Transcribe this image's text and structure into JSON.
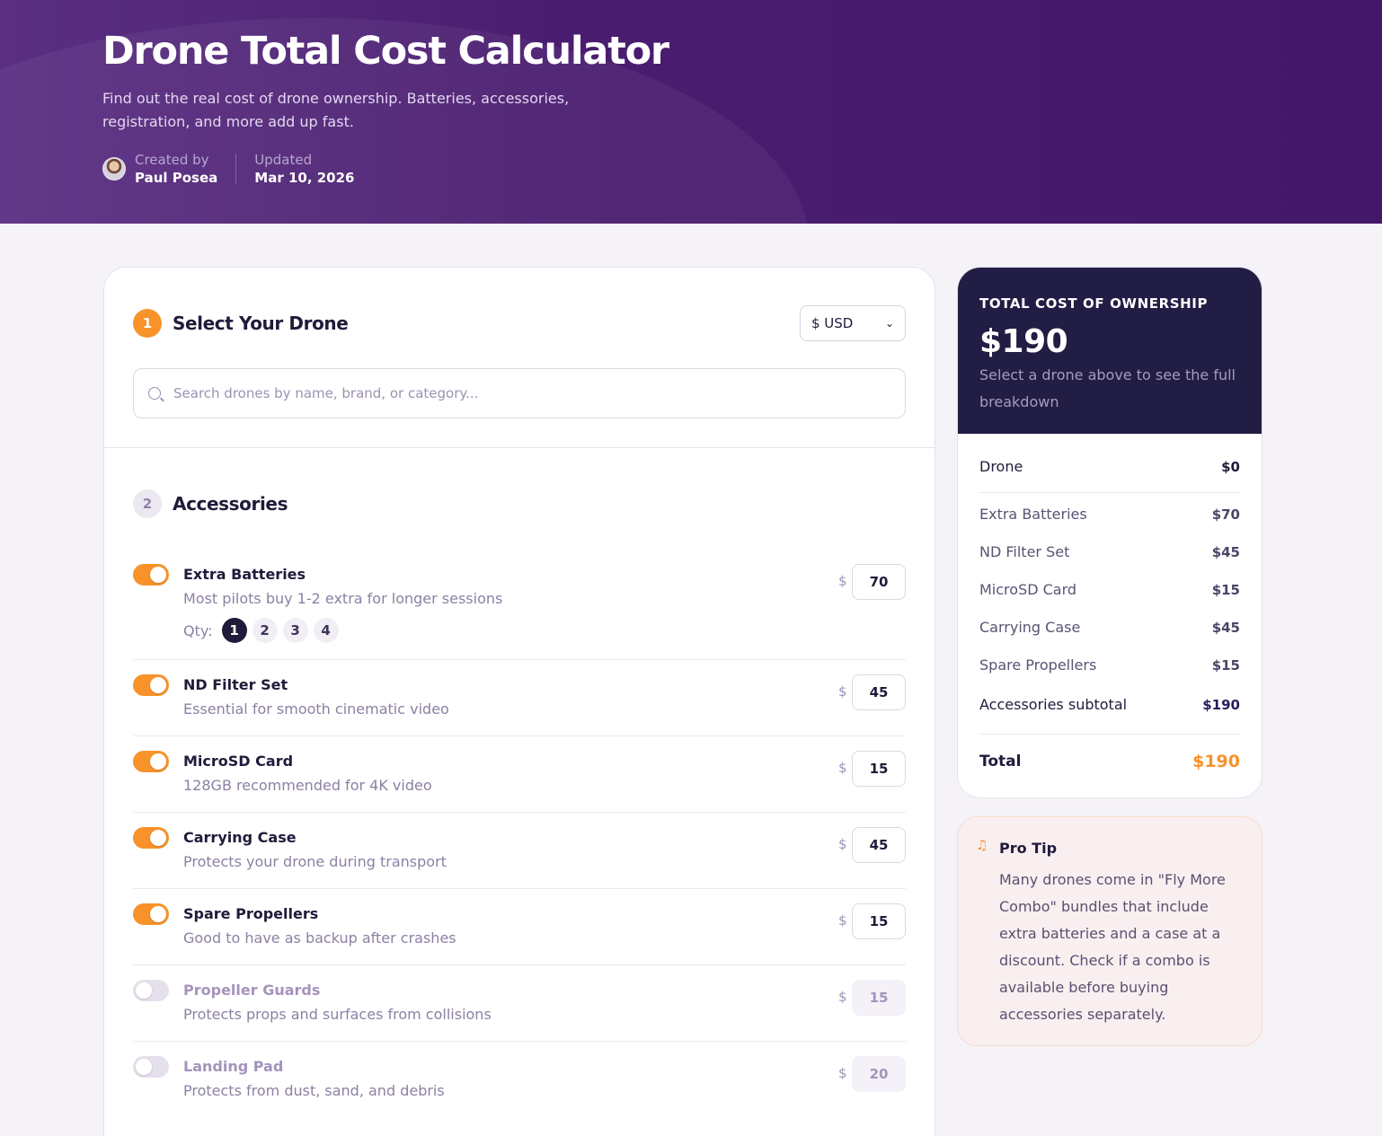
{
  "header": {
    "title": "Drone Total Cost Calculator",
    "subtitle": "Find out the real cost of drone ownership. Batteries, accessories, registration, and more add up fast.",
    "created_label": "Created by",
    "author": "Paul Posea",
    "updated_label": "Updated",
    "updated_date": "Mar 10, 2026"
  },
  "step1": {
    "number": "1",
    "title": "Select Your Drone",
    "currency": "$ USD",
    "search_placeholder": "Search drones by name, brand, or category..."
  },
  "step2": {
    "number": "2",
    "title": "Accessories",
    "currency_symbol": "$",
    "qty_label": "Qty:",
    "qty_options": [
      "1",
      "2",
      "3",
      "4"
    ],
    "qty_selected": "1",
    "items": [
      {
        "name": "Extra Batteries",
        "desc": "Most pilots buy 1-2 extra for longer sessions",
        "price": "70",
        "enabled": true
      },
      {
        "name": "ND Filter Set",
        "desc": "Essential for smooth cinematic video",
        "price": "45",
        "enabled": true
      },
      {
        "name": "MicroSD Card",
        "desc": "128GB recommended for 4K video",
        "price": "15",
        "enabled": true
      },
      {
        "name": "Carrying Case",
        "desc": "Protects your drone during transport",
        "price": "45",
        "enabled": true
      },
      {
        "name": "Spare Propellers",
        "desc": "Good to have as backup after crashes",
        "price": "15",
        "enabled": true
      },
      {
        "name": "Propeller Guards",
        "desc": "Protects props and surfaces from collisions",
        "price": "15",
        "enabled": false
      },
      {
        "name": "Landing Pad",
        "desc": "Protects from dust, sand, and debris",
        "price": "20",
        "enabled": false
      }
    ]
  },
  "summary": {
    "label": "TOTAL COST OF OWNERSHIP",
    "total": "$190",
    "hint": "Select a drone above to see the full breakdown",
    "drone_label": "Drone",
    "drone_value": "$0",
    "rows": [
      {
        "label": "Extra Batteries",
        "value": "$70"
      },
      {
        "label": "ND Filter Set",
        "value": "$45"
      },
      {
        "label": "MicroSD Card",
        "value": "$15"
      },
      {
        "label": "Carrying Case",
        "value": "$45"
      },
      {
        "label": "Spare Propellers",
        "value": "$15"
      }
    ],
    "subtotal_label": "Accessories subtotal",
    "subtotal_value": "$190",
    "total_label": "Total",
    "total_value": "$190"
  },
  "tip": {
    "icon": "music-note-icon",
    "title": "Pro Tip",
    "body": "Many drones come in \"Fly More Combo\" bundles that include extra batteries and a case at a discount. Check if a combo is available before buying accessories separately."
  },
  "colors": {
    "accent": "#f7932a",
    "hero": "#4a1d70",
    "summary_dark": "#211d44"
  }
}
